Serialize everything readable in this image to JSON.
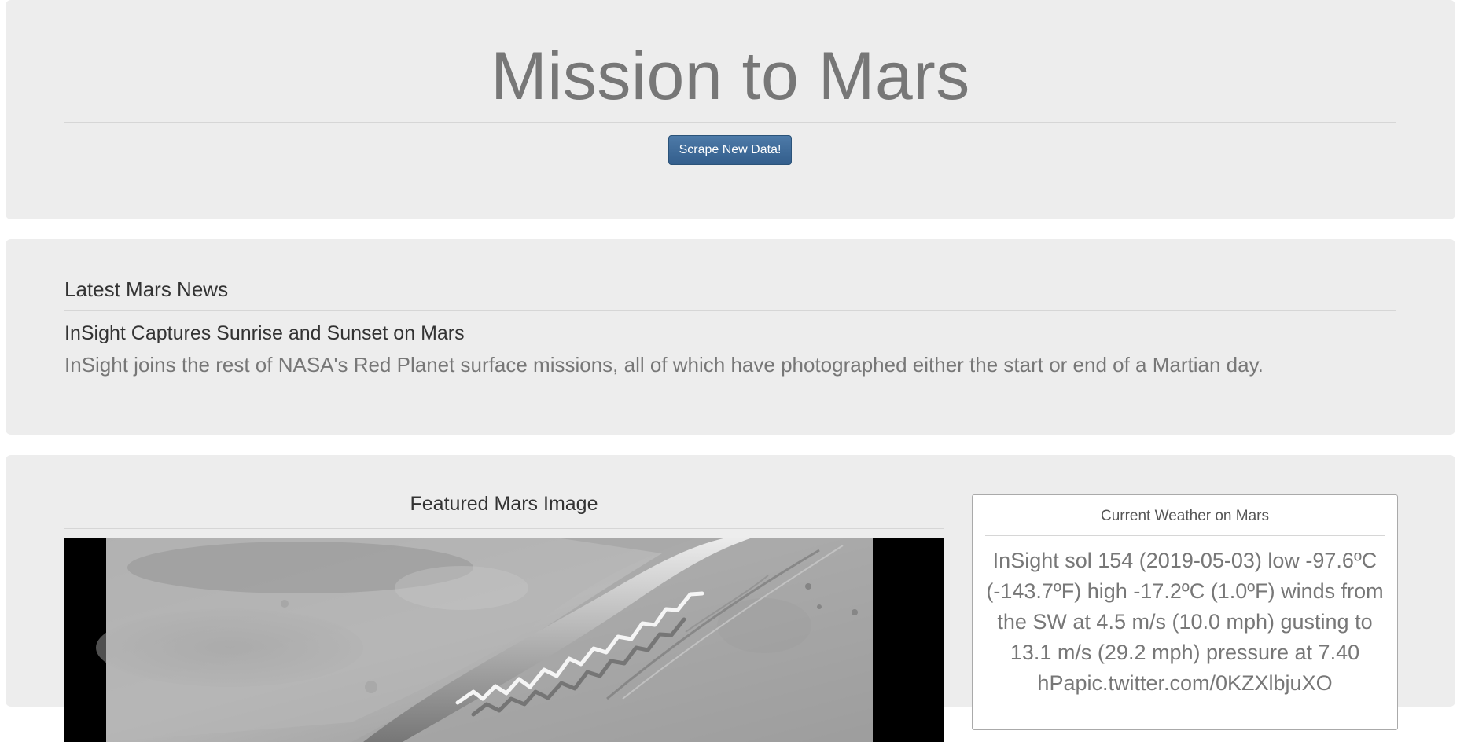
{
  "header": {
    "title": "Mission to Mars",
    "scrape_button_label": "Scrape New Data!"
  },
  "news": {
    "section_title": "Latest Mars News",
    "headline": "InSight Captures Sunrise and Sunset on Mars",
    "teaser": "InSight joins the rest of NASA's Red Planet surface missions, all of which have photographed either the start or end of a Martian day."
  },
  "featured": {
    "section_title": "Featured Mars Image"
  },
  "weather": {
    "title": "Current Weather on Mars",
    "text": "InSight sol 154 (2019-05-03) low -97.6ºC (-143.7ºF) high -17.2ºC (1.0ºF) winds from the SW at 4.5 m/s (10.0 mph) gusting to 13.1 m/s (29.2 mph) pressure at 7.40 hPapic.twitter.com/0KZXlbjuXO"
  },
  "colors": {
    "panel_background": "#ededed",
    "button_background": "#3f6b98",
    "title_gray": "#777777"
  }
}
